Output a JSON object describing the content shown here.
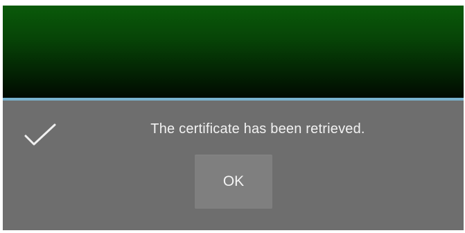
{
  "dialog": {
    "message": "The certificate has been retrieved.",
    "icon": "checkmark-icon",
    "ok_label": "OK"
  },
  "colors": {
    "header_top": "#0a5a0a",
    "header_bottom": "#010a01",
    "divider": "#79b3cf",
    "dialog_bg": "#6e6e6e",
    "button_bg": "#7f7f7f",
    "text": "#f2f2f2"
  }
}
